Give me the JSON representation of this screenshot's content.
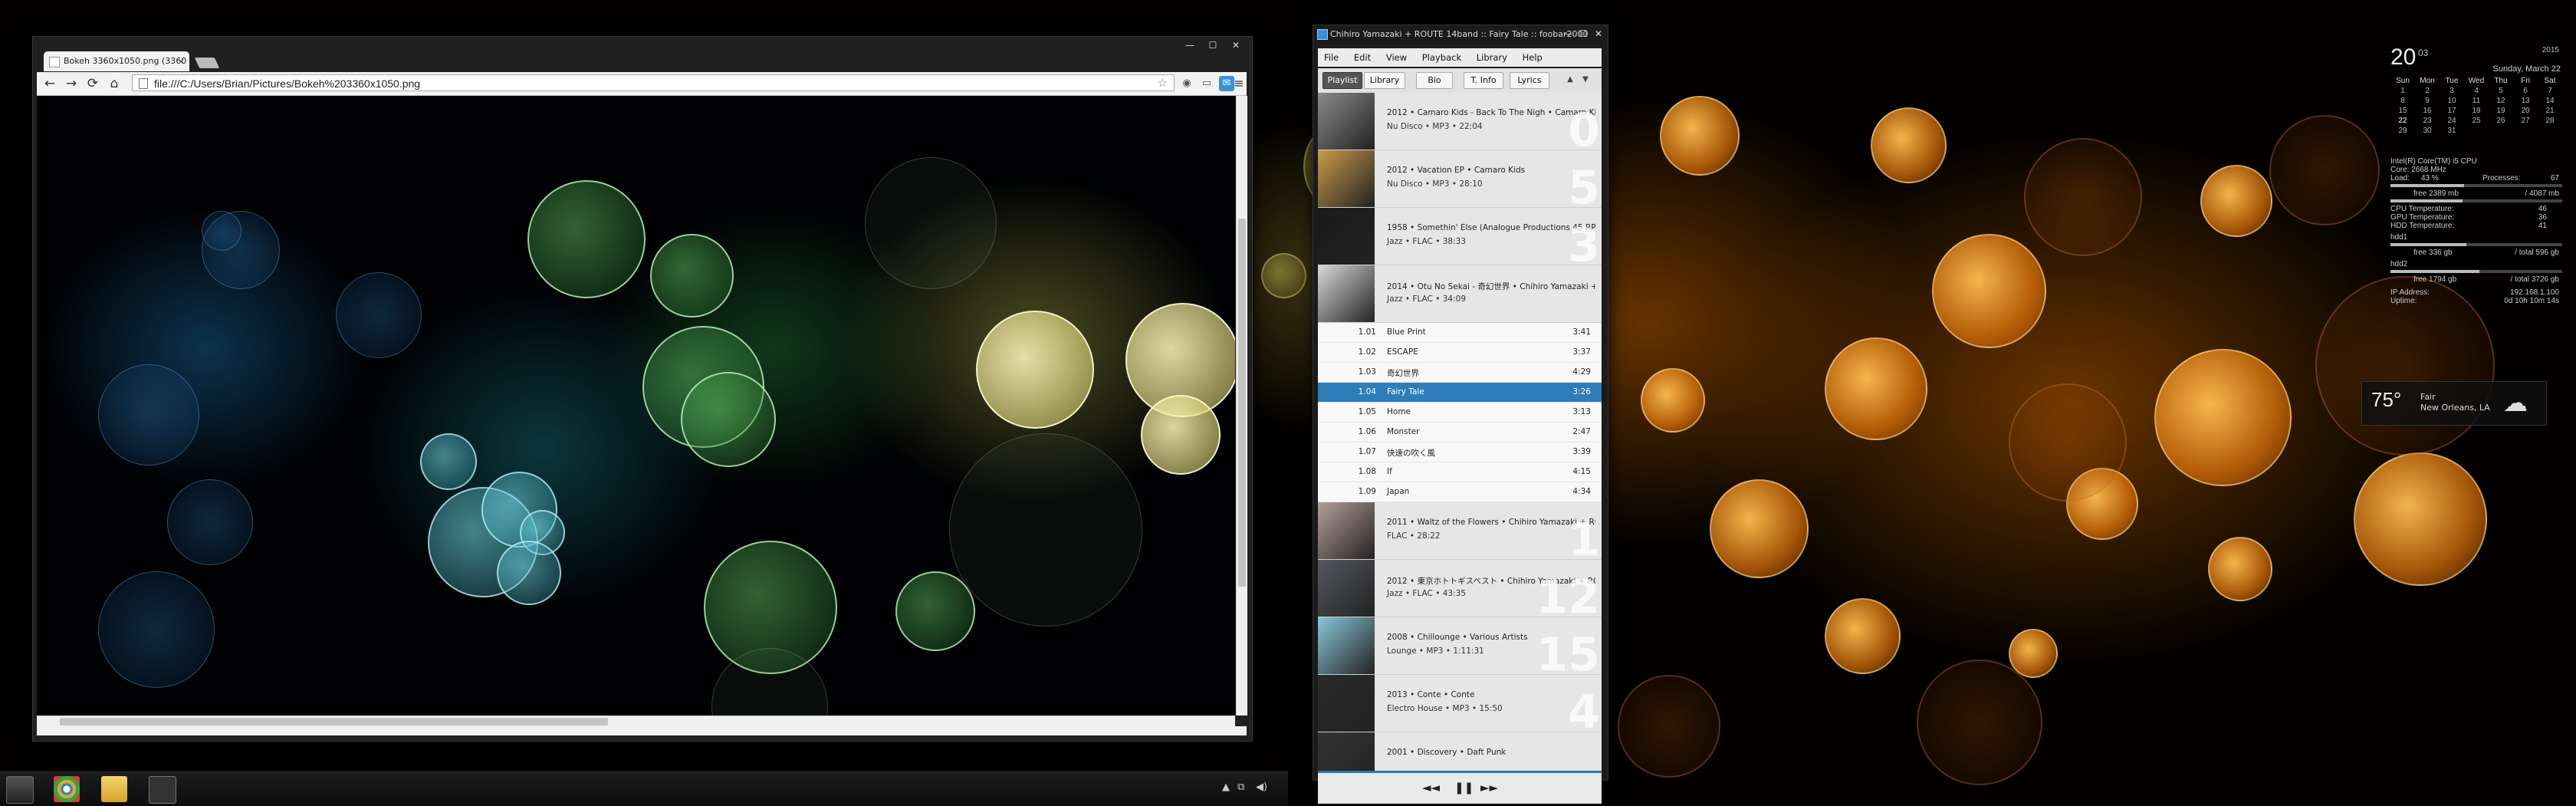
{
  "browser": {
    "tab_title": "Bokeh 3360x1050.png (3360",
    "tab_close": "×",
    "url": "file:///C:/Users/Brian/Pictures/Bokeh%203360x1050.png",
    "back": "←",
    "forward": "→",
    "reload": "⟳",
    "home": "⌂",
    "star": "☆",
    "menu": "≡",
    "caption": [
      "—",
      "☐",
      "✕"
    ]
  },
  "player": {
    "title": "Chihiro Yamazaki + ROUTE 14band :: Fairy Tale :: foobar2000",
    "caption": [
      "—",
      "☐",
      "✕"
    ],
    "menu": [
      "File",
      "Edit",
      "View",
      "Playback",
      "Library",
      "Help"
    ],
    "tabs": [
      "Playlist",
      "Library",
      "Bio",
      "T. Info",
      "Lyrics"
    ],
    "active_tab": "Playlist",
    "nav_up": "▲",
    "nav_down": "▼",
    "albums_before": [
      {
        "line1": "2012 • Camaro Kids - Back To The Nigh • Camaro Kids",
        "line2": "Nu Disco • MP3 • 22:04",
        "ghost": "0",
        "color": "#8a8a8a"
      },
      {
        "line1": "2012 • Vacation EP • Camaro Kids",
        "line2": "Nu Disco • MP3 • 28:10",
        "ghost": "5",
        "color": "#c99a4a"
      },
      {
        "line1": "1958 • Somethin' Else (Analogue Productions 45 RPM) •",
        "line2": "Jazz • FLAC • 38:33",
        "ghost": "3",
        "color": "#1a1a1a"
      },
      {
        "line1": "2014 • Otu No Sekai - 奇幻世界 • Chihiro Yamazaki + ROU",
        "line2": "Jazz • FLAC • 34:09",
        "ghost": "",
        "color": "#d9d9d9"
      }
    ],
    "tracks": [
      {
        "n": "1.01",
        "t": "Blue Print",
        "d": "3:41"
      },
      {
        "n": "1.02",
        "t": "ESCAPE",
        "d": "3:37"
      },
      {
        "n": "1.03",
        "t": "奇幻世界",
        "d": "4:29"
      },
      {
        "n": "1.04",
        "t": "Fairy Tale",
        "d": "3:26"
      },
      {
        "n": "1.05",
        "t": "Home",
        "d": "3:13"
      },
      {
        "n": "1.06",
        "t": "Monster",
        "d": "2:47"
      },
      {
        "n": "1.07",
        "t": "快速の吹く風",
        "d": "3:39"
      },
      {
        "n": "1.08",
        "t": "If",
        "d": "4:15"
      },
      {
        "n": "1.09",
        "t": "Japan",
        "d": "4:34"
      }
    ],
    "selected_track": 3,
    "albums_after": [
      {
        "line1": "2011 • Waltz of the Flowers • Chihiro Yamazaki + ROUTE",
        "line2": "FLAC • 28:22",
        "ghost": "1",
        "color": "#b59f9a"
      },
      {
        "line1": "2012 • 東京ホトトギスベスト • Chihiro Yamazaki + ROUTE14band",
        "line2": "Jazz • FLAC • 43:35",
        "ghost": "12",
        "color": "#55585e"
      },
      {
        "line1": "2008 • Chillounge • Various Artists",
        "line2": "Lounge • MP3 • 1:11:31",
        "ghost": "15",
        "color": "#88c6da"
      },
      {
        "line1": "2013 • Conte • Conte",
        "line2": "Electro House • MP3 • 15:50",
        "ghost": "4",
        "color": "#2a2a2a"
      },
      {
        "line1": "2001 • Discovery • Daft Punk",
        "line2": "",
        "ghost": "",
        "color": "#333333"
      }
    ],
    "controls": {
      "prev": "◄◄",
      "pause": "❚❚",
      "next": "►►"
    }
  },
  "taskbar": {
    "tray_arrow": "▲",
    "tray_net": "⧉",
    "tray_vol": "◀)"
  },
  "calendar": {
    "day": "20",
    "month": "03",
    "year": "2015",
    "full_date": "Sunday, March 22",
    "weekdays": [
      "Sun",
      "Mon",
      "Tue",
      "Wed",
      "Thu",
      "Fri",
      "Sat"
    ],
    "weeks": [
      [
        "1",
        "2",
        "3",
        "4",
        "5",
        "6",
        "7"
      ],
      [
        "8",
        "9",
        "10",
        "11",
        "12",
        "13",
        "14"
      ],
      [
        "15",
        "16",
        "17",
        "18",
        "19",
        "20",
        "21"
      ],
      [
        "22",
        "23",
        "24",
        "25",
        "26",
        "27",
        "28"
      ],
      [
        "29",
        "30",
        "31",
        "",
        "",
        "",
        ""
      ]
    ],
    "today": "22"
  },
  "sysmon": {
    "cpu_name": "Intel(R) Core(TM) i5 CPU",
    "cpu_speed": "Core: 2668 MHz",
    "load_label": "Load:",
    "load_value": "43 %",
    "proc_label": "Processes:",
    "proc_value": "67",
    "load_fraction": 0.43,
    "ram_free": "free 2389 mb",
    "ram_total": "/ 4087 mb",
    "ram_fraction": 0.42,
    "cpu_temp_label": "CPU Temperature:",
    "cpu_temp": "46",
    "gpu_temp_label": "GPU Temperature:",
    "gpu_temp": "36",
    "hdd_temp_label": "HDD Temperature:",
    "hdd_temp": "41",
    "hdd1_label": "hdd1",
    "hdd1_free": "free 336 gb",
    "hdd1_total": "/ total 596 gb",
    "hdd1_fraction": 0.44,
    "hdd2_label": "hdd2",
    "hdd2_free": "free 1794 gb",
    "hdd2_total": "/ total 3726 gb",
    "hdd2_fraction": 0.52,
    "ip_label": "IP Address:",
    "ip": "192.168.1.100",
    "uptime_label": "Uptime:",
    "uptime": "0d 10h 10m 14s"
  },
  "weather": {
    "temp": "75°",
    "condition": "Fair",
    "location": "New Orleans, LA",
    "icon": "☁"
  }
}
